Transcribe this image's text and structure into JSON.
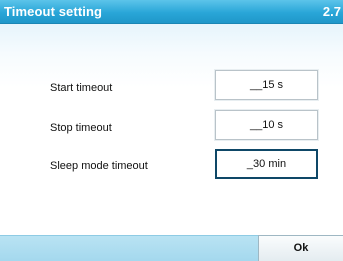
{
  "header": {
    "title": "Timeout setting",
    "number": "2.7"
  },
  "settings": [
    {
      "label": "Start timeout",
      "value": "__15 s"
    },
    {
      "label": "Stop timeout",
      "value": "__10 s"
    },
    {
      "label": "Sleep mode timeout",
      "value": "_30 min"
    }
  ],
  "footer": {
    "ok_label": "Ok"
  },
  "colors": {
    "title_bar": "#29a6d8",
    "footer_bar": "#a4d8ee",
    "active_field_border": "#0e4767"
  }
}
